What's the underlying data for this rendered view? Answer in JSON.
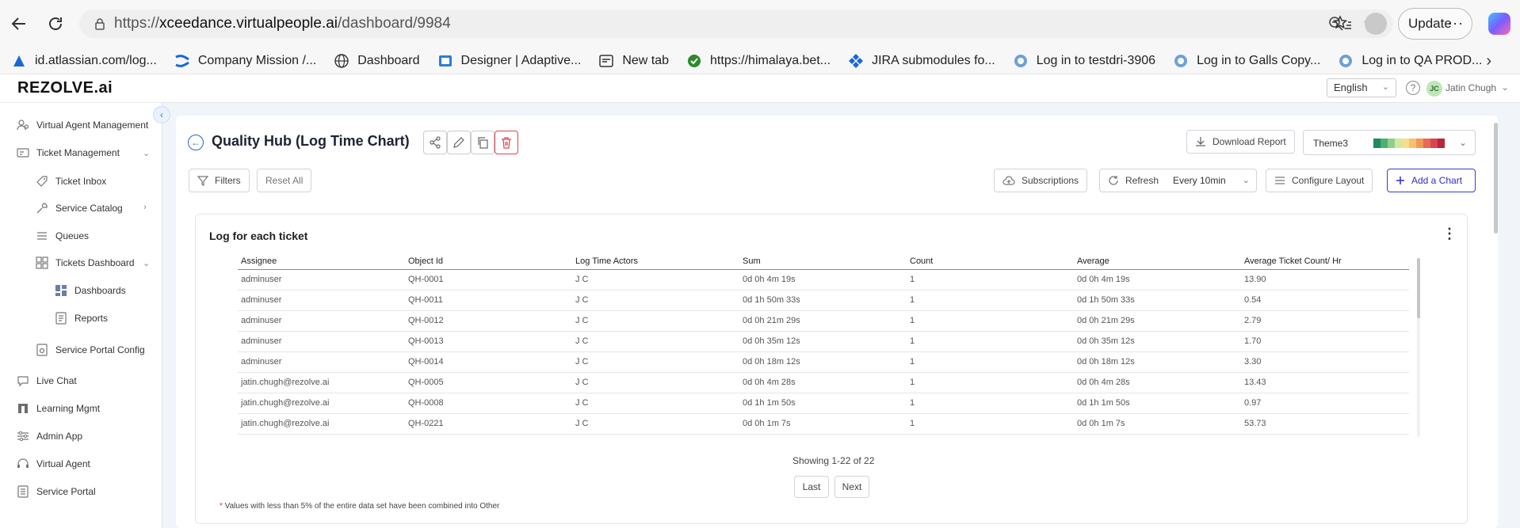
{
  "browser": {
    "url_prefix": "https://",
    "url_domain": "xceedance.virtualpeople.ai",
    "url_path": "/dashboard/9984",
    "update_label": "Update",
    "more_label": "···",
    "bookmarks": [
      {
        "label": "id.atlassian.com/log...",
        "icon": "atlassian-icon"
      },
      {
        "label": "Company Mission /...",
        "icon": "confluence-icon"
      },
      {
        "label": "Dashboard",
        "icon": "globe-icon"
      },
      {
        "label": "Designer | Adaptive...",
        "icon": "designer-icon"
      },
      {
        "label": "New tab",
        "icon": "newtab-icon"
      },
      {
        "label": "https://himalaya.bet...",
        "icon": "check-badge-icon"
      },
      {
        "label": "JIRA submodules fo...",
        "icon": "jira-icon"
      },
      {
        "label": "Log in to testdri-3906",
        "icon": "servicenow-icon"
      },
      {
        "label": "Log in to Galls Copy...",
        "icon": "servicenow-icon"
      },
      {
        "label": "Log in to QA PROD...",
        "icon": "servicenow-icon"
      }
    ]
  },
  "header": {
    "logo": "REZOLVE.ai",
    "language": "English",
    "user_initials": "JC",
    "user_name": "Jatin Chugh"
  },
  "sidebar": {
    "items": [
      {
        "label": "Virtual Agent Management"
      },
      {
        "label": "Ticket Management"
      },
      {
        "label": "Ticket Inbox"
      },
      {
        "label": "Service Catalog"
      },
      {
        "label": "Queues"
      },
      {
        "label": "Tickets Dashboard"
      },
      {
        "label": "Dashboards"
      },
      {
        "label": "Reports"
      },
      {
        "label": "Service Portal Config"
      },
      {
        "label": "Live Chat"
      },
      {
        "label": "Learning Mgmt"
      },
      {
        "label": "Admin App"
      },
      {
        "label": "Virtual Agent"
      },
      {
        "label": "Service Portal"
      }
    ]
  },
  "page": {
    "title": "Quality Hub (Log Time Chart)",
    "download_report": "Download Report",
    "theme": "Theme3",
    "theme_colors": [
      "#1f8a5b",
      "#4caf73",
      "#8fcf86",
      "#cfe8a3",
      "#f4e08a",
      "#f6c26b",
      "#f09a58",
      "#e56b55",
      "#d94452",
      "#b8263d"
    ],
    "filters": "Filters",
    "reset_all": "Reset All",
    "subscriptions": "Subscriptions",
    "refresh": "Refresh",
    "refresh_interval": "Every 10min",
    "configure_layout": "Configure Layout",
    "add_chart": "Add a Chart"
  },
  "chart_data": {
    "type": "table",
    "title": "Log for each ticket",
    "columns": [
      "Assignee",
      "Object Id",
      "Log Time Actors",
      "Sum",
      "Count",
      "Average",
      "Average Ticket Count/ Hr"
    ],
    "rows": [
      [
        "adminuser",
        "QH-0001",
        "J C",
        "0d 0h 4m 19s",
        "1",
        "0d 0h 4m 19s",
        "13.90"
      ],
      [
        "adminuser",
        "QH-0011",
        "J C",
        "0d 1h 50m 33s",
        "1",
        "0d 1h 50m 33s",
        "0.54"
      ],
      [
        "adminuser",
        "QH-0012",
        "J C",
        "0d 0h 21m 29s",
        "1",
        "0d 0h 21m 29s",
        "2.79"
      ],
      [
        "adminuser",
        "QH-0013",
        "J C",
        "0d 0h 35m 12s",
        "1",
        "0d 0h 35m 12s",
        "1.70"
      ],
      [
        "adminuser",
        "QH-0014",
        "J C",
        "0d 0h 18m 12s",
        "1",
        "0d 0h 18m 12s",
        "3.30"
      ],
      [
        "jatin.chugh@rezolve.ai",
        "QH-0005",
        "J C",
        "0d 0h 4m 28s",
        "1",
        "0d 0h 4m 28s",
        "13.43"
      ],
      [
        "jatin.chugh@rezolve.ai",
        "QH-0008",
        "J C",
        "0d 1h 1m 50s",
        "1",
        "0d 1h 1m 50s",
        "0.97"
      ],
      [
        "jatin.chugh@rezolve.ai",
        "QH-0221",
        "J C",
        "0d 0h 1m 7s",
        "1",
        "0d 0h 1m 7s",
        "53.73"
      ]
    ],
    "showing": "Showing 1-22 of 22",
    "last": "Last",
    "next": "Next",
    "footnote_star": "*",
    "footnote": " Values with less than 5% of the entire data set have been combined into Other"
  }
}
